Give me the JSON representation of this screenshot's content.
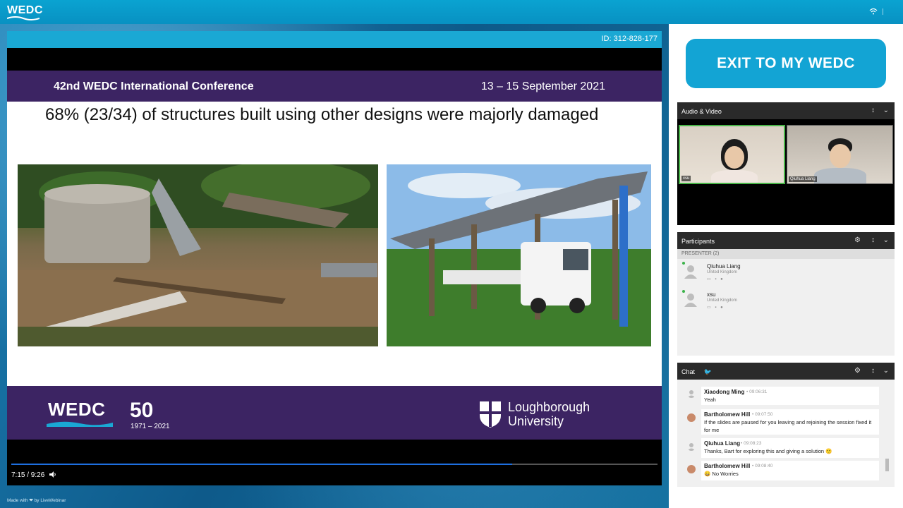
{
  "topbar": {
    "logo": "WEDC"
  },
  "player": {
    "meeting_id": "ID: 312-828-177",
    "time": "7:15 / 9:26",
    "progress_fraction": 0.775
  },
  "slide": {
    "conference_title": "42nd WEDC International Conference",
    "conference_date": "13 – 15 September 2021",
    "body_text": "68% (23/34) of structures built using other designs were majorly damaged",
    "footer_logo": "WEDC",
    "fifty": "50",
    "years": "1971 – 2021",
    "university_line1": "Loughborough",
    "university_line2": "University"
  },
  "footer": {
    "made_with": "Made with ❤ by LiveWebinar"
  },
  "sidebar": {
    "exit_button": "EXIT TO MY WEDC",
    "audio_video": {
      "title": "Audio & Video",
      "cams": [
        {
          "label": "xsu"
        },
        {
          "label": "Qiuhua Liang"
        }
      ]
    },
    "participants": {
      "title": "Participants",
      "section": "PRESENTER (2)",
      "people": [
        {
          "name": "Qiuhua Liang",
          "country": "United Kingdom"
        },
        {
          "name": "xsu",
          "country": "United Kingdom"
        }
      ]
    },
    "chat": {
      "title": "Chat",
      "messages": [
        {
          "name": "Xiaodong Ming",
          "time": "• 09:06:31",
          "text": "Yeah"
        },
        {
          "name": "Bartholomew Hill",
          "time": "• 09:07:50",
          "text": "If the slides are paused for you leaving and rejoining the session fixed it for me"
        },
        {
          "name": "Qiuhua Liang",
          "time": "• 09:08:23",
          "text": "Thanks, Bart for exploring this and giving a solution 🙂"
        },
        {
          "name": "Bartholomew Hill",
          "time": "• 09:08:40",
          "text": "😄 No Worries"
        }
      ]
    }
  },
  "colors": {
    "accent": "#13a4d4",
    "slide_purple": "#3c2463",
    "online": "#3cb34a"
  }
}
